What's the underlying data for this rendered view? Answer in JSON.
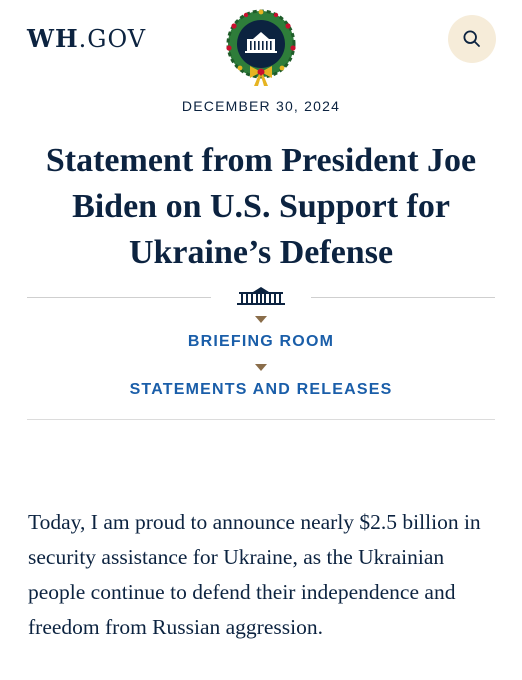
{
  "header": {
    "logo_main": "WH",
    "logo_suffix": ".GOV",
    "seal_icon": "white-house-holiday-wreath-seal",
    "search_icon": "search-icon"
  },
  "article": {
    "date": "DECEMBER 30, 2024",
    "title": "Statement from President Joe Biden on U.S. Support for Ukraine’s Defense",
    "breadcrumbs": [
      {
        "label": "BRIEFING ROOM"
      },
      {
        "label": "STATEMENTS AND RELEASES"
      }
    ],
    "body": "Today, I am proud to announce nearly $2.5 billion in security assistance for Ukraine, as the Ukrainian people continue to defend their independence and freedom from Russian aggression."
  },
  "colors": {
    "navy": "#0c2340",
    "link_blue": "#1a5ea9",
    "search_bg": "#f6ecd9",
    "caret_brown": "#8a6d4a",
    "wreath_green": "#2e7d3a"
  }
}
